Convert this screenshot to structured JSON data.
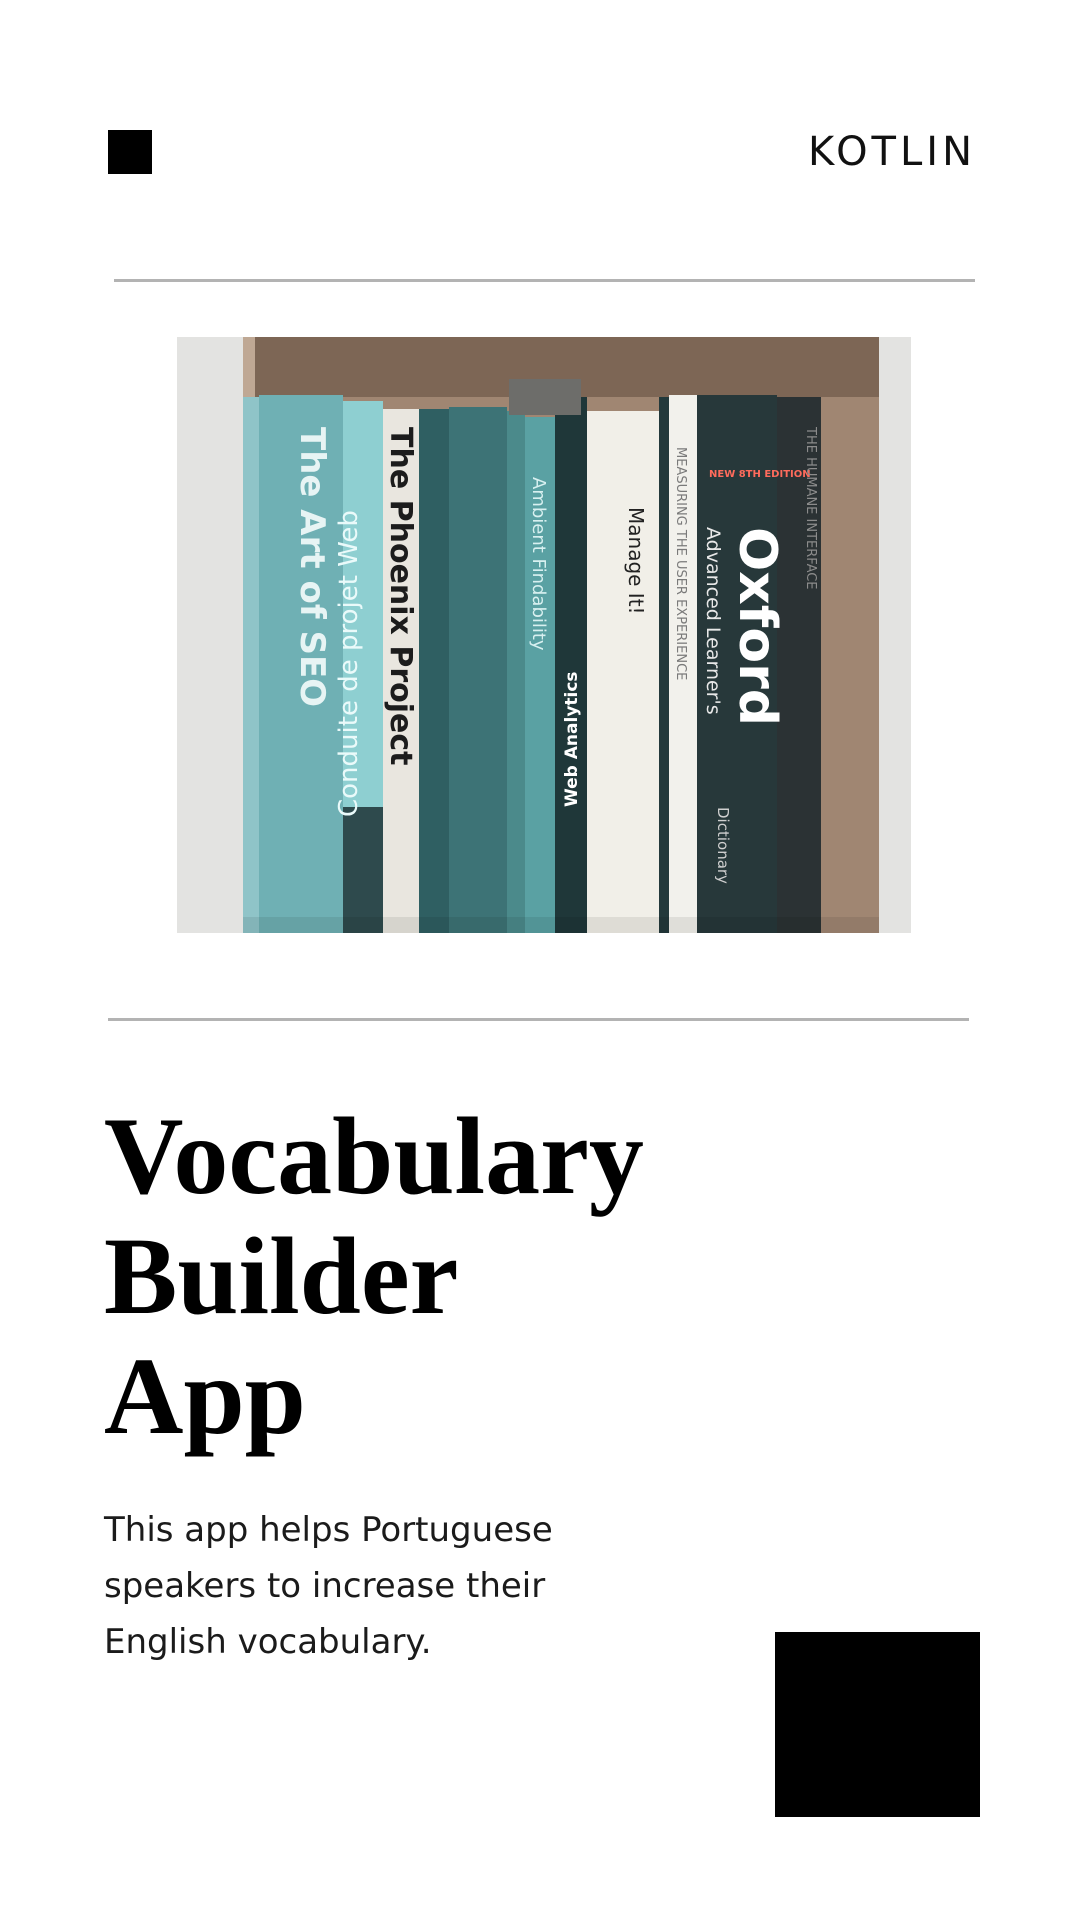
{
  "header": {
    "brand": "KOTLIN",
    "logo_icon": "black-square-icon"
  },
  "hero_image": {
    "description": "bookshelf-photo",
    "spines": [
      "The Art of SEO",
      "Conduite de projet Web",
      "The Phoenix Project",
      "Ambient Findability",
      "Web Analytics",
      "Manage It!",
      "MEASURING THE USER EXPERIENCE",
      "Oxford",
      "Advanced Learner's",
      "Dictionary",
      "NEW 8TH EDITION",
      "THE HUMANE INTERFACE"
    ]
  },
  "main": {
    "title_lines": [
      "Vocabulary",
      "Builder",
      "App"
    ],
    "description": "This app helps Portuguese speakers to increase their English vocabulary."
  },
  "decor": {
    "corner_square": "black-square"
  },
  "colors": {
    "accent": "#000000",
    "divider": "#b3b3b3",
    "background": "#ffffff"
  }
}
